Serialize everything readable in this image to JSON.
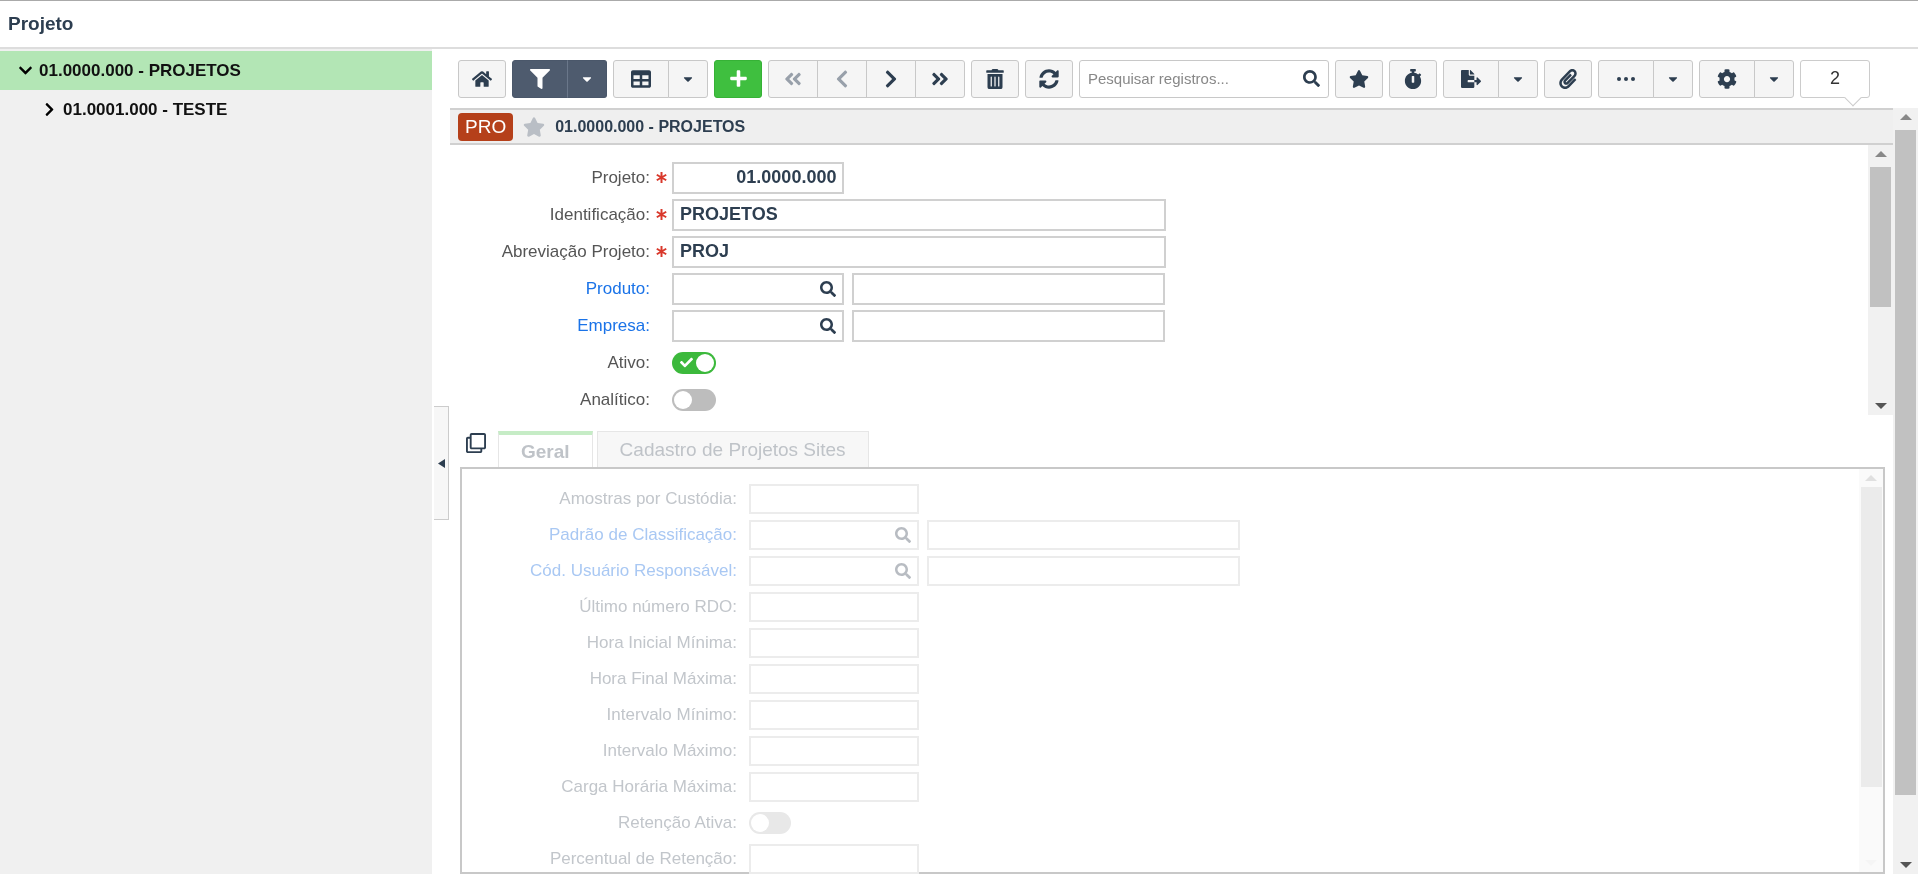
{
  "page_title": "Projeto",
  "tree": [
    {
      "label": "01.0000.000 - PROJETOS",
      "selected": true,
      "expanded": true,
      "children": [
        {
          "label": "01.0001.000 - TESTE",
          "selected": false,
          "expanded": false
        }
      ]
    }
  ],
  "toolbar": [
    {
      "kind": "button"
    },
    {
      "kind": "split",
      "active": true
    },
    {
      "kind": "split",
      "active": false
    },
    {
      "kind": "add"
    },
    {
      "kind": "nav",
      "buttons": [
        {
          "disabled": true
        },
        {
          "disabled": true
        },
        {
          "disabled": false
        },
        {
          "disabled": false
        }
      ]
    },
    {
      "kind": "button"
    },
    {
      "kind": "button"
    },
    {
      "kind": "search",
      "placeholder": "Pesquisar registros..."
    },
    {
      "kind": "button"
    },
    {
      "kind": "button"
    },
    {
      "kind": "split",
      "active": false
    },
    {
      "kind": "button"
    },
    {
      "kind": "split",
      "active": false
    },
    {
      "kind": "split",
      "active": false
    },
    {
      "kind": "counter",
      "value": "2"
    }
  ],
  "record": {
    "badge": "PRO",
    "favorite": false,
    "title": "01.0000.000 - PROJETOS"
  },
  "form": [
    {
      "label": "Projeto:",
      "kind": "code",
      "required": true,
      "link": false,
      "value": "01.0000.000"
    },
    {
      "label": "Identificação:",
      "kind": "text",
      "required": true,
      "link": false,
      "value": "PROJETOS"
    },
    {
      "label": "Abreviação Projeto:",
      "kind": "text",
      "required": true,
      "link": false,
      "value": "PROJ"
    },
    {
      "label": "Produto:",
      "kind": "lookup",
      "required": false,
      "link": true
    },
    {
      "label": "Empresa:",
      "kind": "lookup",
      "required": false,
      "link": true
    },
    {
      "label": "Ativo:",
      "kind": "toggle",
      "required": false,
      "link": false,
      "on": true
    },
    {
      "label": "Analítico:",
      "kind": "toggle",
      "required": false,
      "link": false,
      "on": false
    }
  ],
  "tabs": [
    {
      "label": "Geral",
      "selected": true
    },
    {
      "label": "Cadastro de Projetos Sites",
      "selected": false
    }
  ],
  "tab_panel": {
    "disabled": true,
    "fields": [
      {
        "label": "Amostras por Custódia:",
        "kind": "code",
        "link": false
      },
      {
        "label": "Padrão de Classificação:",
        "kind": "lookup",
        "link": true
      },
      {
        "label": "Cód. Usuário Responsável:",
        "kind": "lookup",
        "link": true
      },
      {
        "label": "Último número RDO:",
        "kind": "code",
        "link": false
      },
      {
        "label": "Hora Inicial Mínima:",
        "kind": "code",
        "link": false
      },
      {
        "label": "Hora Final Máxima:",
        "kind": "code",
        "link": false
      },
      {
        "label": "Intervalo Mínimo:",
        "kind": "code",
        "link": false
      },
      {
        "label": "Intervalo Máximo:",
        "kind": "code",
        "link": false
      },
      {
        "label": "Carga Horária Máxima:",
        "kind": "code",
        "link": false
      },
      {
        "label": "Retenção Ativa:",
        "kind": "toggle",
        "link": false,
        "on": false
      },
      {
        "label": "Percentual de Retenção:",
        "kind": "code",
        "link": false
      }
    ]
  }
}
